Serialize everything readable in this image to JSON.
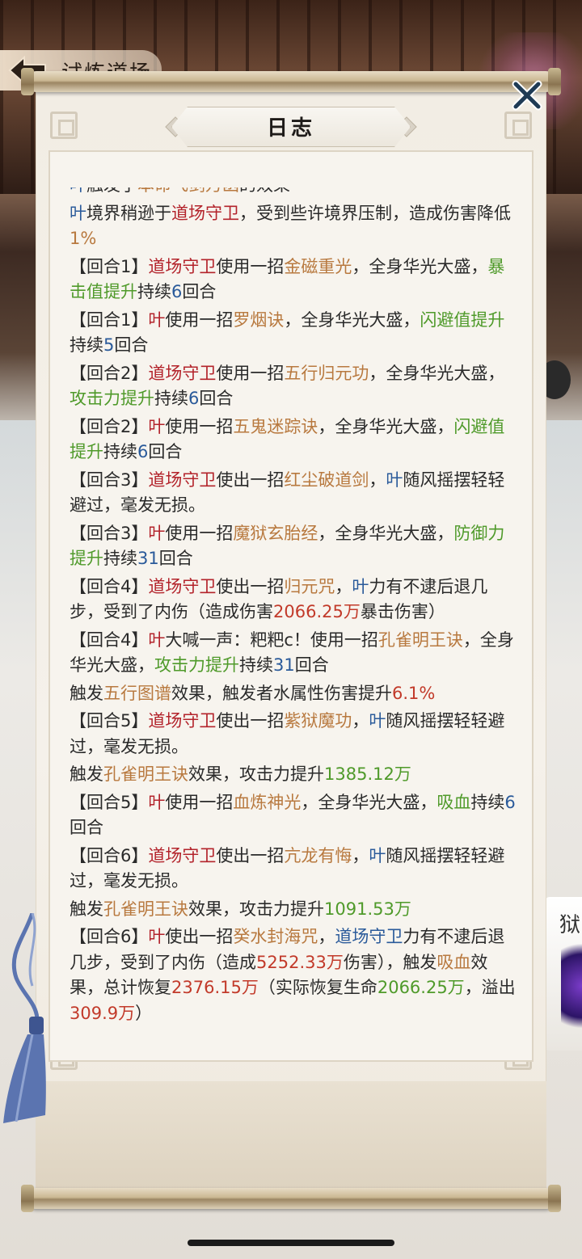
{
  "header": {
    "title": "试炼道场"
  },
  "dialog": {
    "title": "日志",
    "close_label": "X"
  },
  "background": {
    "side_label": "狱"
  },
  "colors": {
    "red": "#b3232b",
    "blue": "#2a5a9a",
    "orange": "#b8793f",
    "green": "#4f9a2a"
  },
  "log_entries": [
    [
      [
        "blue",
        "叶"
      ],
      [
        "",
        "触发了"
      ],
      [
        "orange",
        "本命飞剑万函"
      ],
      [
        "",
        "的效果"
      ]
    ],
    [
      [
        "blue",
        "叶"
      ],
      [
        "",
        "境界稍逊于"
      ],
      [
        "red",
        "道场守卫"
      ],
      [
        "",
        "，受到些许境界压制，造成伤害降低"
      ],
      [
        "orange",
        "1%"
      ]
    ],
    [
      [
        "",
        "【回合1】"
      ],
      [
        "red",
        "道场守卫"
      ],
      [
        "",
        "使用一招"
      ],
      [
        "orange",
        "金磁重光"
      ],
      [
        "",
        "，全身华光大盛，"
      ],
      [
        "green",
        "暴击值提升"
      ],
      [
        "",
        "持续"
      ],
      [
        "blue",
        "6"
      ],
      [
        "",
        "回合"
      ]
    ],
    [
      [
        "",
        "【回合1】"
      ],
      [
        "red",
        "叶"
      ],
      [
        "",
        "使用一招"
      ],
      [
        "orange",
        "罗烟诀"
      ],
      [
        "",
        "，全身华光大盛，"
      ],
      [
        "green",
        "闪避值提升"
      ],
      [
        "",
        "持续"
      ],
      [
        "blue",
        "5"
      ],
      [
        "",
        "回合"
      ]
    ],
    [
      [
        "",
        "【回合2】"
      ],
      [
        "red",
        "道场守卫"
      ],
      [
        "",
        "使用一招"
      ],
      [
        "orange",
        "五行归元功"
      ],
      [
        "",
        "，全身华光大盛，"
      ],
      [
        "green",
        "攻击力提升"
      ],
      [
        "",
        "持续"
      ],
      [
        "blue",
        "6"
      ],
      [
        "",
        "回合"
      ]
    ],
    [
      [
        "",
        "【回合2】"
      ],
      [
        "red",
        "叶"
      ],
      [
        "",
        "使用一招"
      ],
      [
        "orange",
        "五鬼迷踪诀"
      ],
      [
        "",
        "，全身华光大盛，"
      ],
      [
        "green",
        "闪避值提升"
      ],
      [
        "",
        "持续"
      ],
      [
        "blue",
        "6"
      ],
      [
        "",
        "回合"
      ]
    ],
    [
      [
        "",
        "【回合3】"
      ],
      [
        "red",
        "道场守卫"
      ],
      [
        "",
        "使出一招"
      ],
      [
        "orange",
        "红尘破道剑"
      ],
      [
        "",
        "，"
      ],
      [
        "blue",
        "叶"
      ],
      [
        "",
        "随风摇摆轻轻避过，毫发无损。"
      ]
    ],
    [
      [
        "",
        "【回合3】"
      ],
      [
        "red",
        "叶"
      ],
      [
        "",
        "使用一招"
      ],
      [
        "orange",
        "魔狱玄胎经"
      ],
      [
        "",
        "，全身华光大盛，"
      ],
      [
        "green",
        "防御力提升"
      ],
      [
        "",
        "持续"
      ],
      [
        "blue",
        "31"
      ],
      [
        "",
        "回合"
      ]
    ],
    [
      [
        "",
        "【回合4】"
      ],
      [
        "red",
        "道场守卫"
      ],
      [
        "",
        "使出一招"
      ],
      [
        "orange",
        "归元咒"
      ],
      [
        "",
        "，"
      ],
      [
        "blue",
        "叶"
      ],
      [
        "",
        "力有不逮后退几步，受到了内伤（造成伤害"
      ],
      [
        "numred",
        "2066.25万"
      ],
      [
        "",
        "暴击伤害）"
      ]
    ],
    [
      [
        "",
        "【回合4】"
      ],
      [
        "red",
        "叶"
      ],
      [
        "",
        "大喊一声：粑粑c！使用一招"
      ],
      [
        "orange",
        "孔雀明王诀"
      ],
      [
        "",
        "，全身华光大盛，"
      ],
      [
        "green",
        "攻击力提升"
      ],
      [
        "",
        "持续"
      ],
      [
        "blue",
        "31"
      ],
      [
        "",
        "回合"
      ]
    ],
    [
      [
        "",
        "触发"
      ],
      [
        "orange",
        "五行图谱"
      ],
      [
        "",
        "效果，触发者水属性伤害提升"
      ],
      [
        "numred",
        "6.1%"
      ]
    ],
    [
      [
        "",
        "【回合5】"
      ],
      [
        "red",
        "道场守卫"
      ],
      [
        "",
        "使出一招"
      ],
      [
        "orange",
        "紫狱魔功"
      ],
      [
        "",
        "，"
      ],
      [
        "blue",
        "叶"
      ],
      [
        "",
        "随风摇摆轻轻避过，毫发无损。"
      ]
    ],
    [
      [
        "",
        "触发"
      ],
      [
        "orange",
        "孔雀明王诀"
      ],
      [
        "",
        "效果，攻击力提升"
      ],
      [
        "numgreen",
        "1385.12万"
      ]
    ],
    [
      [
        "",
        "【回合5】"
      ],
      [
        "red",
        "叶"
      ],
      [
        "",
        "使用一招"
      ],
      [
        "orange",
        "血炼神光"
      ],
      [
        "",
        "，全身华光大盛，"
      ],
      [
        "green",
        "吸血"
      ],
      [
        "",
        "持续"
      ],
      [
        "blue",
        "6"
      ],
      [
        "",
        "回合"
      ]
    ],
    [
      [
        "",
        "【回合6】"
      ],
      [
        "red",
        "道场守卫"
      ],
      [
        "",
        "使出一招"
      ],
      [
        "orange",
        "亢龙有悔"
      ],
      [
        "",
        "，"
      ],
      [
        "blue",
        "叶"
      ],
      [
        "",
        "随风摇摆轻轻避过，毫发无损。"
      ]
    ],
    [
      [
        "",
        "触发"
      ],
      [
        "orange",
        "孔雀明王诀"
      ],
      [
        "",
        "效果，攻击力提升"
      ],
      [
        "numgreen",
        "1091.53万"
      ]
    ],
    [
      [
        "",
        "【回合6】"
      ],
      [
        "red",
        "叶"
      ],
      [
        "",
        "使出一招"
      ],
      [
        "orange",
        "癸水封海咒"
      ],
      [
        "",
        "，"
      ],
      [
        "blue",
        "道场守卫"
      ],
      [
        "",
        "力有不逮后退几步，受到了内伤（造成"
      ],
      [
        "numred",
        "5252.33万"
      ],
      [
        "",
        "伤害），触发"
      ],
      [
        "orange",
        "吸血"
      ],
      [
        "",
        "效果，总计恢复"
      ],
      [
        "numred",
        "2376.15万"
      ],
      [
        "",
        "（实际恢复生命"
      ],
      [
        "numgreen",
        "2066.25万"
      ],
      [
        "",
        "，溢出"
      ],
      [
        "numred",
        "309.9万"
      ],
      [
        "",
        "）"
      ]
    ]
  ]
}
